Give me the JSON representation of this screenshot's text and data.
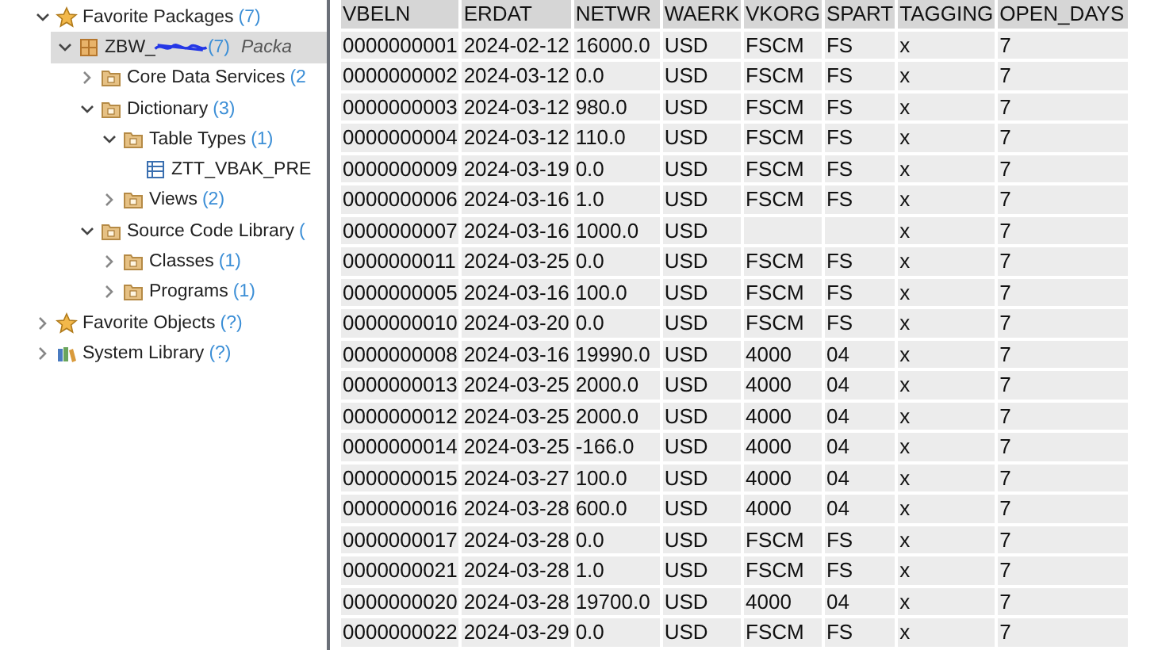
{
  "tree": [
    {
      "label": "Favorite Packages",
      "count": "(7)",
      "kind": "star",
      "selected": false,
      "expanded": true,
      "children": [
        {
          "label": "ZBW_",
          "redacted": true,
          "count": "(7)",
          "note": "Packa",
          "kind": "package",
          "selected": true,
          "expanded": true,
          "children": [
            {
              "label": "Core Data Services",
              "count": "(2",
              "kind": "folder",
              "selected": false,
              "expanded": false
            },
            {
              "label": "Dictionary",
              "count": "(3)",
              "kind": "folder",
              "selected": false,
              "expanded": true,
              "children": [
                {
                  "label": "Table Types",
                  "count": "(1)",
                  "kind": "folder",
                  "selected": false,
                  "expanded": true,
                  "children": [
                    {
                      "label": "ZTT_VBAK_PRE",
                      "kind": "tabletype",
                      "selected": false
                    }
                  ]
                },
                {
                  "label": "Views",
                  "count": "(2)",
                  "kind": "folder",
                  "selected": false,
                  "expanded": false
                }
              ]
            },
            {
              "label": "Source Code Library",
              "count": "(",
              "kind": "folder",
              "selected": false,
              "expanded": true,
              "children": [
                {
                  "label": "Classes",
                  "count": "(1)",
                  "kind": "folder",
                  "selected": false,
                  "expanded": false
                },
                {
                  "label": "Programs",
                  "count": "(1)",
                  "kind": "folder",
                  "selected": false,
                  "expanded": false
                }
              ]
            }
          ]
        }
      ]
    },
    {
      "label": "Favorite Objects",
      "count": "(?)",
      "kind": "star",
      "selected": false,
      "expanded": false
    },
    {
      "label": "System Library",
      "count": "(?)",
      "kind": "library",
      "selected": false,
      "expanded": false
    }
  ],
  "table": {
    "columns": [
      "VBELN",
      "ERDAT",
      "NETWR",
      "WAERK",
      "VKORG",
      "SPART",
      "TAGGING",
      "OPEN_DAYS"
    ],
    "rows": [
      [
        "0000000001",
        "2024-02-12",
        "16000.0",
        "USD",
        "FSCM",
        "FS",
        "x",
        "7"
      ],
      [
        "0000000002",
        "2024-03-12",
        "0.0",
        "USD",
        "FSCM",
        "FS",
        "x",
        "7"
      ],
      [
        "0000000003",
        "2024-03-12",
        "980.0",
        "USD",
        "FSCM",
        "FS",
        "x",
        "7"
      ],
      [
        "0000000004",
        "2024-03-12",
        "110.0",
        "USD",
        "FSCM",
        "FS",
        "x",
        "7"
      ],
      [
        "0000000009",
        "2024-03-19",
        "0.0",
        "USD",
        "FSCM",
        "FS",
        "x",
        "7"
      ],
      [
        "0000000006",
        "2024-03-16",
        "1.0",
        "USD",
        "FSCM",
        "FS",
        "x",
        "7"
      ],
      [
        "0000000007",
        "2024-03-16",
        "1000.0",
        "USD",
        null,
        null,
        "x",
        "7"
      ],
      [
        "0000000011",
        "2024-03-25",
        "0.0",
        "USD",
        "FSCM",
        "FS",
        "x",
        "7"
      ],
      [
        "0000000005",
        "2024-03-16",
        "100.0",
        "USD",
        "FSCM",
        "FS",
        "x",
        "7"
      ],
      [
        "0000000010",
        "2024-03-20",
        "0.0",
        "USD",
        "FSCM",
        "FS",
        "x",
        "7"
      ],
      [
        "0000000008",
        "2024-03-16",
        "19990.0",
        "USD",
        "4000",
        "04",
        "x",
        "7"
      ],
      [
        "0000000013",
        "2024-03-25",
        "2000.0",
        "USD",
        "4000",
        "04",
        "x",
        "7"
      ],
      [
        "0000000012",
        "2024-03-25",
        "2000.0",
        "USD",
        "4000",
        "04",
        "x",
        "7"
      ],
      [
        "0000000014",
        "2024-03-25",
        "-166.0",
        "USD",
        "4000",
        "04",
        "x",
        "7"
      ],
      [
        "0000000015",
        "2024-03-27",
        "100.0",
        "USD",
        "4000",
        "04",
        "x",
        "7"
      ],
      [
        "0000000016",
        "2024-03-28",
        "600.0",
        "USD",
        "4000",
        "04",
        "x",
        "7"
      ],
      [
        "0000000017",
        "2024-03-28",
        "0.0",
        "USD",
        "FSCM",
        "FS",
        "x",
        "7"
      ],
      [
        "0000000021",
        "2024-03-28",
        "1.0",
        "USD",
        "FSCM",
        "FS",
        "x",
        "7"
      ],
      [
        "0000000020",
        "2024-03-28",
        "19700.0",
        "USD",
        "4000",
        "04",
        "x",
        "7"
      ],
      [
        "0000000022",
        "2024-03-29",
        "0.0",
        "USD",
        "FSCM",
        "FS",
        "x",
        "7"
      ]
    ]
  }
}
